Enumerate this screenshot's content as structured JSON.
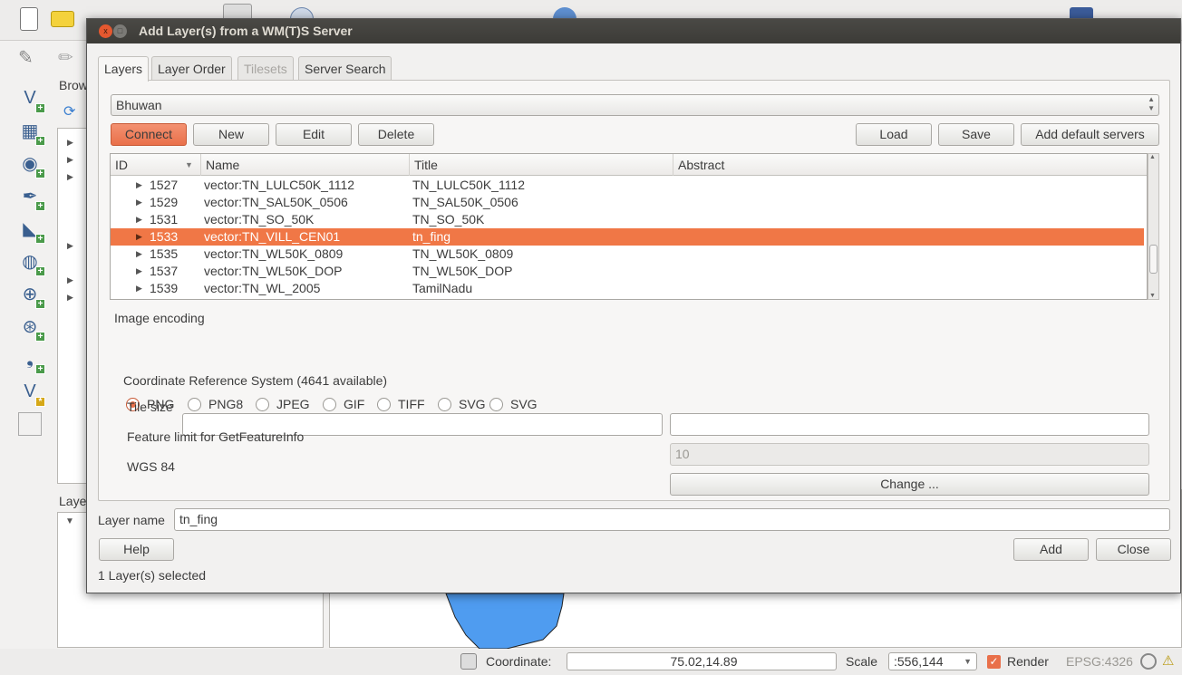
{
  "app": {
    "browser_panel_label": "Brow",
    "layers_panel_label": "Laye",
    "status": {
      "coordinate_label": "Coordinate:",
      "coordinate_value": "75.02,14.89",
      "scale_label": "Scale",
      "scale_value": ":556,144",
      "render_label": "Render",
      "render_checked": true,
      "crs": "EPSG:4326"
    },
    "map_fill": "#4f9cf0"
  },
  "dialog": {
    "title": "Add Layer(s) from a WM(T)S Server",
    "tabs": [
      {
        "label": "Layers",
        "active": true
      },
      {
        "label": "Layer Order"
      },
      {
        "label": "Tilesets",
        "disabled": true
      },
      {
        "label": "Server Search"
      }
    ],
    "server": "Bhuwan",
    "buttons": {
      "connect": "Connect",
      "new": "New",
      "edit": "Edit",
      "delete": "Delete",
      "load": "Load",
      "save": "Save",
      "add_default": "Add default servers"
    },
    "table": {
      "columns": [
        "ID",
        "Name",
        "Title",
        "Abstract"
      ],
      "rows": [
        {
          "id": "1527",
          "name": "vector:TN_LULC50K_1112",
          "title": "TN_LULC50K_1112"
        },
        {
          "id": "1529",
          "name": "vector:TN_SAL50K_0506",
          "title": "TN_SAL50K_0506"
        },
        {
          "id": "1531",
          "name": "vector:TN_SO_50K",
          "title": "TN_SO_50K"
        },
        {
          "id": "1533",
          "name": "vector:TN_VILL_CEN01",
          "title": "tn_fing",
          "selected": true
        },
        {
          "id": "1535",
          "name": "vector:TN_WL50K_0809",
          "title": "TN_WL50K_0809"
        },
        {
          "id": "1537",
          "name": "vector:TN_WL50K_DOP",
          "title": "TN_WL50K_DOP"
        },
        {
          "id": "1539",
          "name": "vector:TN_WL_2005",
          "title": "TamilNadu"
        }
      ]
    },
    "image_encoding": {
      "label": "Image encoding",
      "options": [
        "PNG",
        "PNG8",
        "JPEG",
        "GIF",
        "TIFF",
        "SVG",
        "SVG"
      ],
      "selected": "PNG"
    },
    "crs_label": "Coordinate Reference System (4641 available)",
    "tile_size_label": "Tile size",
    "tile_size_value_1": "",
    "tile_size_value_2": "",
    "feature_limit_label": "Feature limit for GetFeatureInfo",
    "feature_limit_value": "10",
    "crs_name": "WGS 84",
    "change_label": "Change ...",
    "layer_name_label": "Layer name",
    "layer_name_value": "tn_fing",
    "help_label": "Help",
    "add_label": "Add",
    "close_label": "Close",
    "status": "1 Layer(s) selected",
    "accent": "#f07746"
  }
}
